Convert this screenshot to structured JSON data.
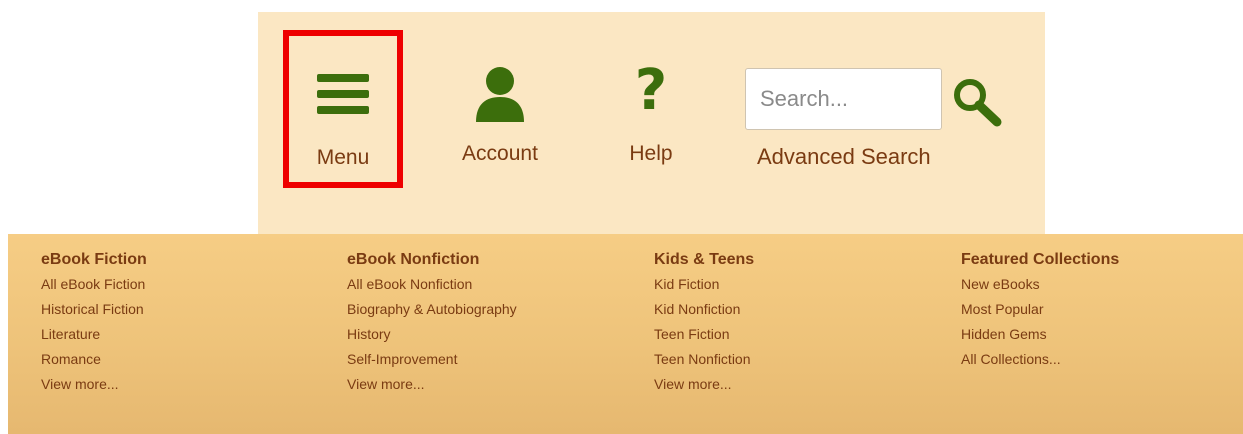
{
  "header": {
    "menu_label": "Menu",
    "account_label": "Account",
    "help_label": "Help",
    "help_glyph": "?",
    "search_placeholder": "Search...",
    "advanced_search_label": "Advanced Search",
    "menu_highlight_color": "#ee0000",
    "icon_color": "#3c6e0c"
  },
  "dropdown": {
    "columns": [
      {
        "heading": "eBook Fiction",
        "links": [
          "All eBook Fiction",
          "Historical Fiction",
          "Literature",
          "Romance",
          "View more..."
        ]
      },
      {
        "heading": "eBook Nonfiction",
        "links": [
          "All eBook Nonfiction",
          "Biography & Autobiography",
          "History",
          "Self-Improvement",
          "View more..."
        ]
      },
      {
        "heading": "Kids & Teens",
        "links": [
          "Kid Fiction",
          "Kid Nonfiction",
          "Teen Fiction",
          "Teen Nonfiction",
          "View more..."
        ]
      },
      {
        "heading": "Featured Collections",
        "links": [
          "New eBooks",
          "Most Popular",
          "Hidden Gems",
          "All Collections..."
        ]
      }
    ]
  }
}
